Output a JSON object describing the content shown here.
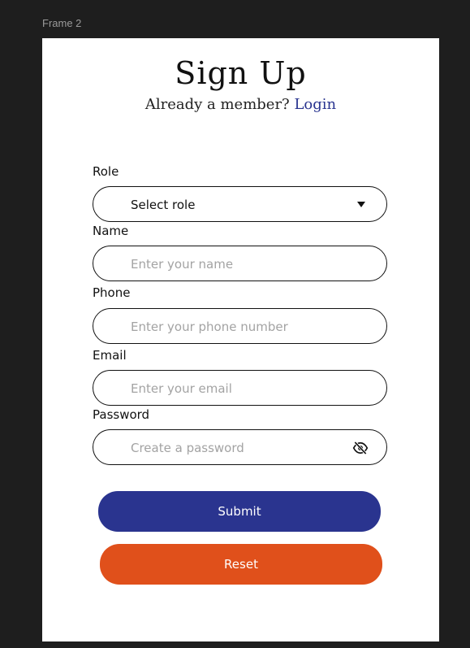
{
  "canvas": {
    "frame_label": "Frame 2"
  },
  "header": {
    "title": "Sign Up",
    "subtitle_prefix": "Already a member?",
    "login_link": "Login"
  },
  "form": {
    "role": {
      "label": "Role",
      "selected": "Select role",
      "icon": "chevron-down-icon"
    },
    "name": {
      "label": "Name",
      "placeholder": "Enter your name"
    },
    "phone": {
      "label": "Phone",
      "placeholder": "Enter your phone number"
    },
    "email": {
      "label": "Email",
      "placeholder": "Enter your email"
    },
    "password": {
      "label": "Password",
      "placeholder": "Create a password",
      "icon": "eye-off-icon"
    }
  },
  "actions": {
    "submit_label": "Submit",
    "reset_label": "Reset"
  },
  "colors": {
    "background": "#1e1e1e",
    "frame": "#ffffff",
    "submit": "#2a348f",
    "reset": "#e0501b",
    "link": "#2a3590",
    "placeholder": "#a3a3a3"
  }
}
